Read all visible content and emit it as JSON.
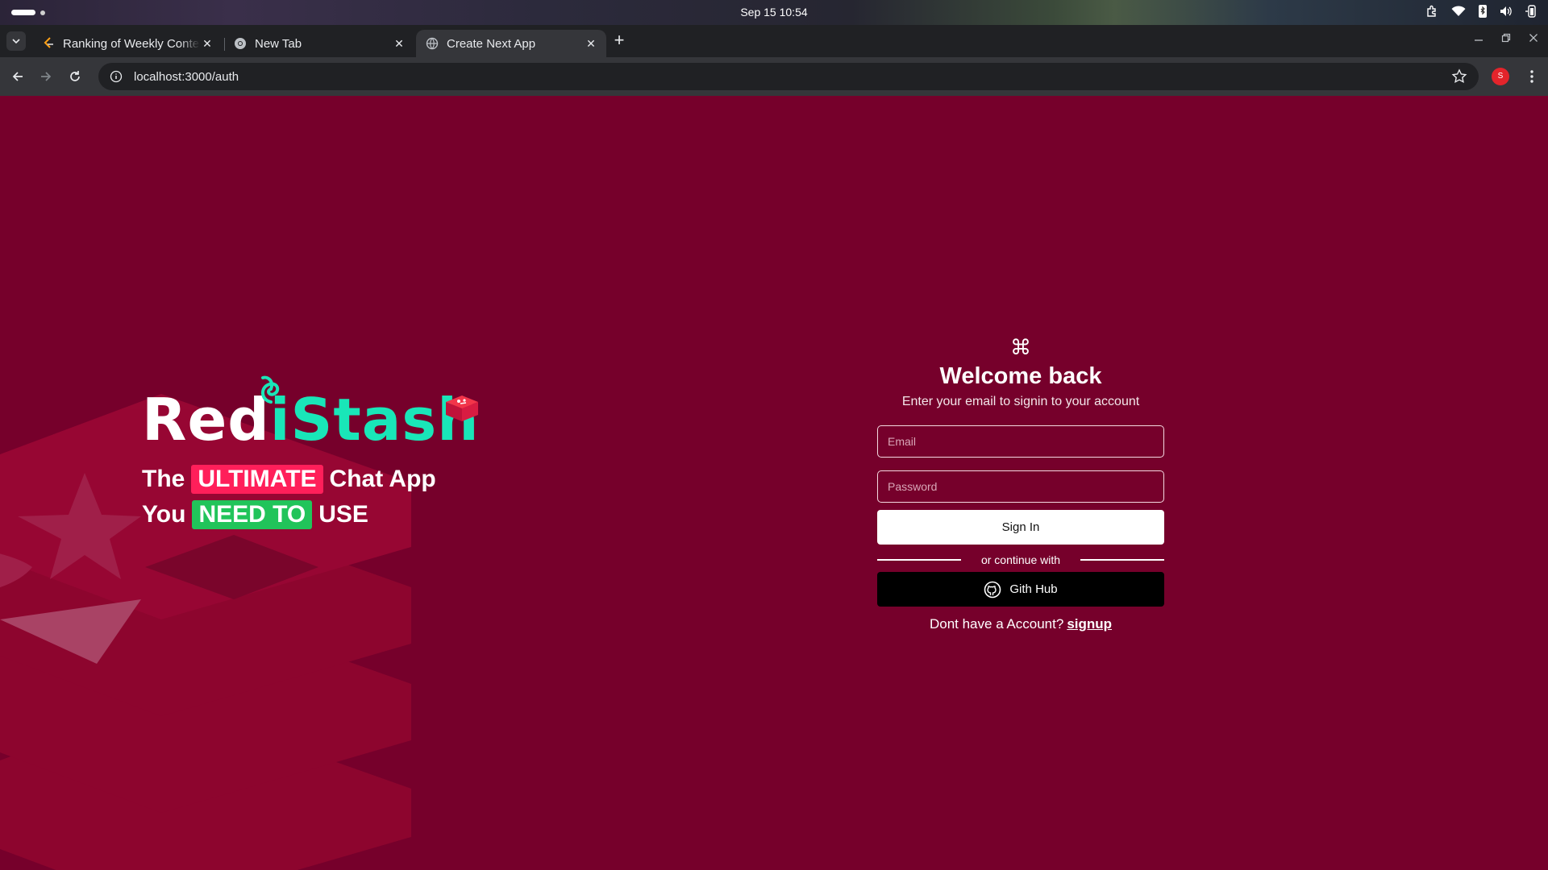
{
  "os": {
    "clock": "Sep 15  10:54"
  },
  "browser": {
    "tabs": [
      {
        "title": "Ranking of Weekly Conte",
        "icon": "leetcode-icon"
      },
      {
        "title": "New Tab",
        "icon": "chrome-icon"
      },
      {
        "title": "Create Next App",
        "icon": "globe-icon",
        "active": true
      }
    ],
    "url": "localhost:3000/auth",
    "profile_initial": "S"
  },
  "brand": {
    "name_part1": "Red",
    "name_part2": "iStash",
    "tagline_line1_pre": "The",
    "tagline_line1_highlight": "ULTIMATE",
    "tagline_line1_post": "Chat App",
    "tagline_line2_pre": "You",
    "tagline_line2_highlight": "NEED TO",
    "tagline_line2_post": "USE"
  },
  "auth": {
    "icon": "⌘",
    "title": "Welcome back",
    "subtitle": "Enter your email to signin to your account",
    "email_placeholder": "Email",
    "password_placeholder": "Password",
    "signin_label": "Sign In",
    "divider_text": "or continue with",
    "github_label": "Gith Hub",
    "signup_prompt": "Dont have a Account?",
    "signup_link": "signup"
  },
  "colors": {
    "page_bg": "#76002b",
    "brand_teal": "#19e6b8",
    "highlight_pink": "#ff1f5a",
    "highlight_green": "#21c45a"
  }
}
